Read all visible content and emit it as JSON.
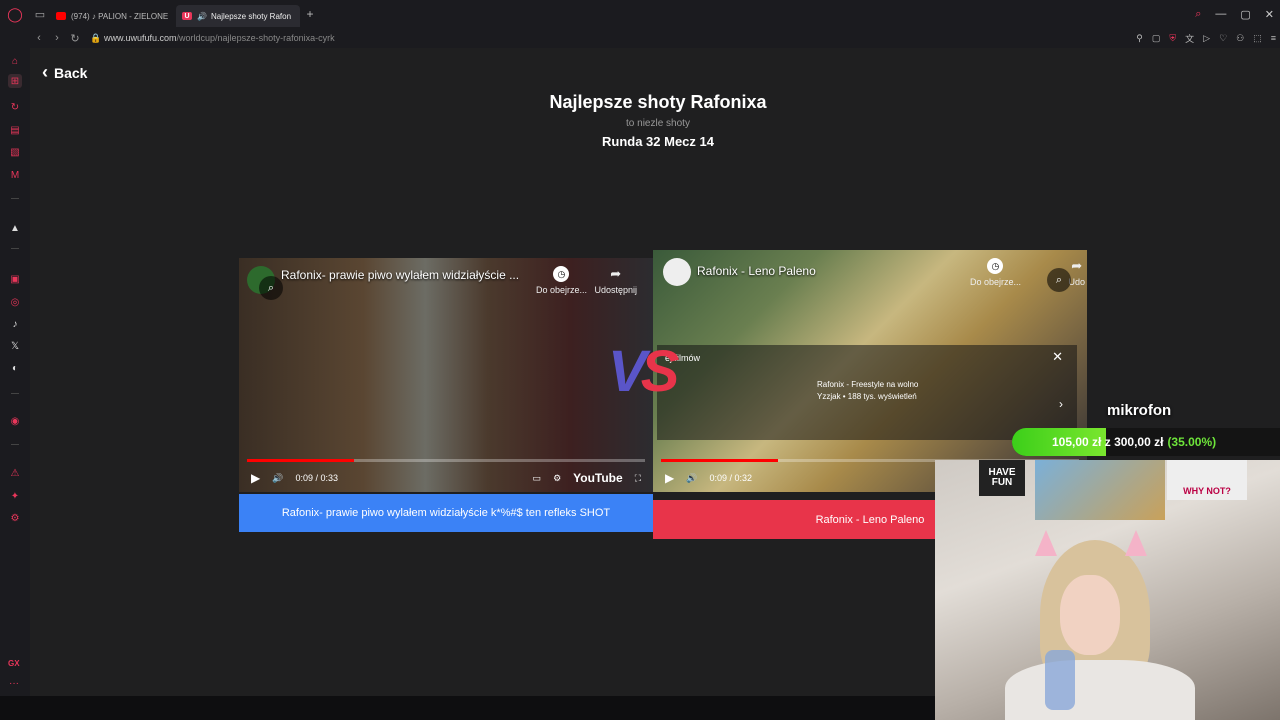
{
  "browser": {
    "tabs": [
      {
        "label": "(974) ♪ PALION - ZIELONE",
        "icon": "youtube-icon"
      },
      {
        "label": "Najlepsze shoty Rafon",
        "icon": "uwufufu-icon",
        "active": true
      }
    ],
    "url_host": "www.uwufufu.com",
    "url_path": "/worldcup/najlepsze-shoty-rafonixa-cyrk",
    "accent_color": "#e8365a"
  },
  "page": {
    "back_label": "Back",
    "title": "Najlepsze shoty Rafonixa",
    "subtitle": "to niezle shoty",
    "round": "Runda 32 Mecz 14",
    "vs_v": "V",
    "vs_s": "S"
  },
  "left_video": {
    "title": "Rafonix- prawie piwo wylałem widziałyście ...",
    "watch_later": "Do obejrze...",
    "share": "Udostępnij",
    "time": "0:09 / 0:33",
    "progress_fraction": 0.27,
    "youtube_label": "YouTube",
    "choice_label": "Rafonix- prawie piwo wylałem widziałyście k*%#$ ten refleks SHOT",
    "choice_color": "#3b82f6"
  },
  "right_video": {
    "title": "Rafonix - Leno Paleno",
    "watch_later": "Do obejrze...",
    "share": "Udo",
    "time": "0:09 / 0:32",
    "progress_fraction": 0.28,
    "panel_header": "ej filmów",
    "rec_title": "Rafonix - Freestyle na wolno",
    "rec_meta": "Yzzjak • 188 tys. wyświetleń",
    "choice_label": "Rafonix - Leno Paleno",
    "choice_color": "#e8344a"
  },
  "overlay": {
    "label": "mikrofon",
    "goal_current": "105,00 zł",
    "goal_sep": "z",
    "goal_target": "300,00 zł",
    "goal_percent": "(35.00%)",
    "goal_fraction": 0.35,
    "poster1": "HAVE FUN",
    "poster3": "WHY NOT?"
  }
}
